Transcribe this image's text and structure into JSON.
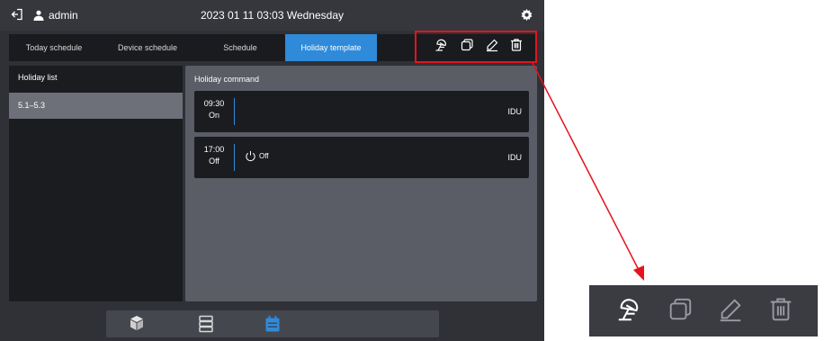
{
  "header": {
    "user": "admin",
    "datetime": "2023 01 11 03:03 Wednesday"
  },
  "tabs": [
    {
      "label": "Today schedule"
    },
    {
      "label": "Device schedule"
    },
    {
      "label": "Schedule"
    },
    {
      "label": "Holiday template"
    }
  ],
  "holiday_list": {
    "title": "Holiday list",
    "items": [
      {
        "label": "5.1–5.3"
      }
    ]
  },
  "holiday_command": {
    "title": "Holiday command",
    "commands": [
      {
        "time": "09:30",
        "state": "On",
        "action": "",
        "device": "IDU"
      },
      {
        "time": "17:00",
        "state": "Off",
        "action": "Off",
        "device": "IDU"
      }
    ]
  },
  "colors": {
    "accent": "#2f8ad9",
    "highlight": "#e3141c"
  },
  "icons": [
    "logout-icon",
    "user-icon",
    "settings-icon",
    "holiday-icon",
    "copy-icon",
    "edit-icon",
    "delete-icon",
    "device-cube-icon",
    "list-icon",
    "calendar-icon",
    "power-icon"
  ]
}
